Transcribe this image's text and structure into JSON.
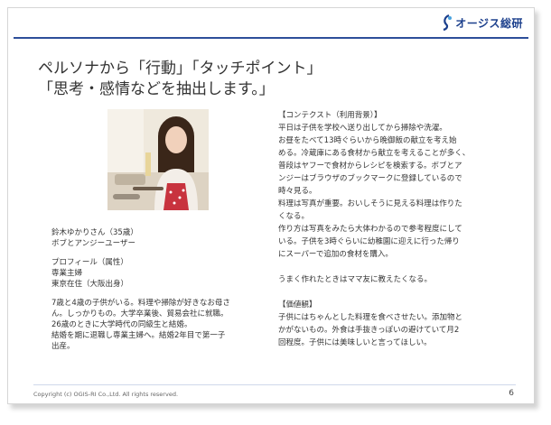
{
  "logo": {
    "text": "オージス総研"
  },
  "title": {
    "line1": "ペルソナから「行動」「タッチポイント」",
    "line2": "「思考・感情などを抽出します。」"
  },
  "persona": {
    "name_line": "鈴木ゆかりさん（35歳）",
    "user_line": "ボブとアンジーユーザー",
    "profile_heading": "プロフィール（属性）",
    "job": "専業主婦",
    "residence": "東京在住（大阪出身）",
    "bio": [
      "7歳と4歳の子供がいる。料理や掃除が好きなお母さ",
      "ん。しっかりもの。大学卒業後、貿易会社に就職。",
      "26歳のときに大学時代の同級生と結婚。",
      "結婚を期に退職し専業主婦へ。結婚2年目で第一子",
      "出産。"
    ]
  },
  "context": {
    "heading": "【コンテクスト（利用背景）】",
    "lines": [
      "平日は子供を学校へ送り出してから掃除や洗濯。",
      "お昼をたべて13時ぐらいから晩御飯の献立を考え始",
      "める。冷蔵庫にある食材から献立を考えることが多く、",
      "普段はヤフーで食材からレシピを検索する。ボブとア",
      "ンジーはブラウザのブックマークに登録しているので",
      "時々見る。",
      "料理は写真が重要。おいしそうに見える料理は作りた",
      "くなる。",
      "作り方は写真をみたら大体わかるので参考程度にして",
      "いる。子供を3時ぐらいに幼稚園に迎えに行った帰り",
      "にスーパーで追加の食材を購入。"
    ],
    "extra": "うまく作れたときはママ友に教えたくなる。"
  },
  "values": {
    "heading": "【価値観】",
    "lines": [
      "子供にはちゃんとした料理を食べさせたい。添加物と",
      "かがないもの。外食は手抜きっぽいの避けていて月2",
      "回程度。子供には美味しいと言ってほしい。"
    ]
  },
  "footer": {
    "copyright": "Copyright (c) OGIS-RI Co.,Ltd. All rights reserved.",
    "page": "6"
  },
  "colors": {
    "brand": "#1b3f8c",
    "rule": "#2d4f9a",
    "text": "#333333"
  }
}
